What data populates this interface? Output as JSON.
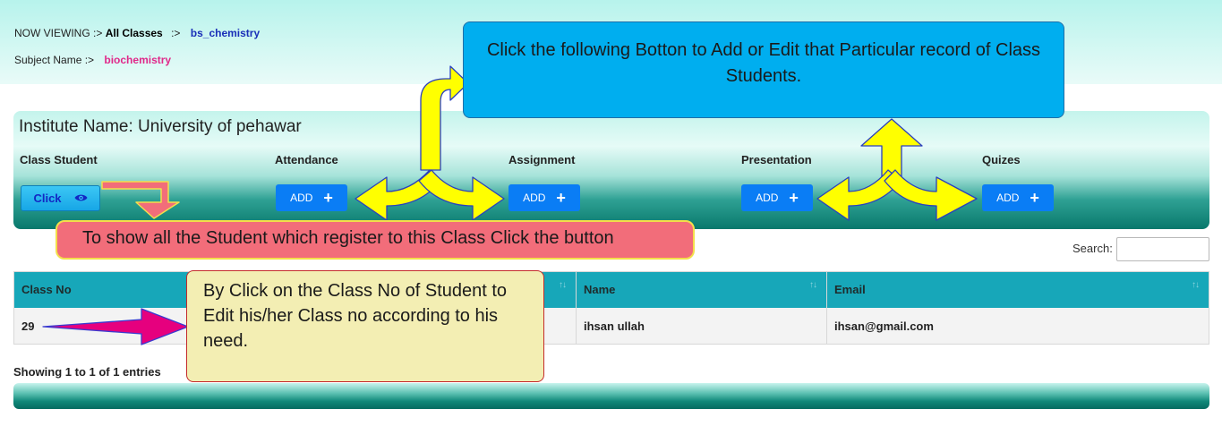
{
  "header": {
    "now_viewing_label": "NOW VIEWING :>",
    "all_classes": "All Classes",
    "separator": ":>",
    "class_name": "bs_chemistry",
    "subject_label": "Subject Name :>",
    "subject_value": "biochemistry"
  },
  "panel": {
    "institute_name": "Institute Name: University of pehawar",
    "columns": {
      "class_student": "Class Student",
      "attendance": "Attendance",
      "assignment": "Assignment",
      "presentation": "Presentation",
      "quizes": "Quizes"
    },
    "click_button_label": "Click",
    "add_button_label": "ADD",
    "eye_icon": "eye-icon",
    "plus_icon": "plus-icon"
  },
  "search": {
    "label": "Search:",
    "value": ""
  },
  "table": {
    "headers": [
      "Class No",
      "Name",
      "Email"
    ],
    "rows": [
      {
        "class_no": "29",
        "name": "ihsan ullah",
        "email": "ihsan@gmail.com"
      }
    ]
  },
  "footer": {
    "showing": "Showing 1 to 1 of 1 entries"
  },
  "callouts": {
    "blue": "Click the following Botton to Add or Edit that Particular record of Class Students.",
    "pink": "To show all the Student which register to this  Class Click the button",
    "yellow": "By Click on the Class No of Student to Edit his/her Class no according to his need."
  },
  "colors": {
    "panel_teal": "#08786c",
    "table_header": "#17a7b9",
    "add_button": "#0a7df5",
    "callout_blue": "#00aeef",
    "callout_pink": "#f26d7a",
    "callout_yellow": "#f3eeb3",
    "arrow_yellow": "#ffff00",
    "arrow_magenta": "#e6007e"
  }
}
